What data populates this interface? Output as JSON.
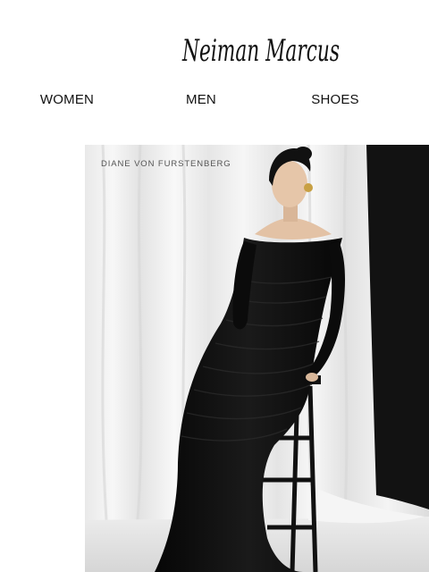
{
  "brand": {
    "name": "Neiman Marcus"
  },
  "nav": {
    "items": [
      {
        "label": "WOMEN"
      },
      {
        "label": "MEN"
      },
      {
        "label": "SHOES"
      }
    ]
  },
  "hero": {
    "caption": "DIANE VON FURSTENBERG"
  },
  "colors": {
    "background": "#ffffff",
    "text": "#111111",
    "curtain_white": "#f2f2f2",
    "curtain_black": "#121212",
    "dress": "#0d0d0d"
  }
}
